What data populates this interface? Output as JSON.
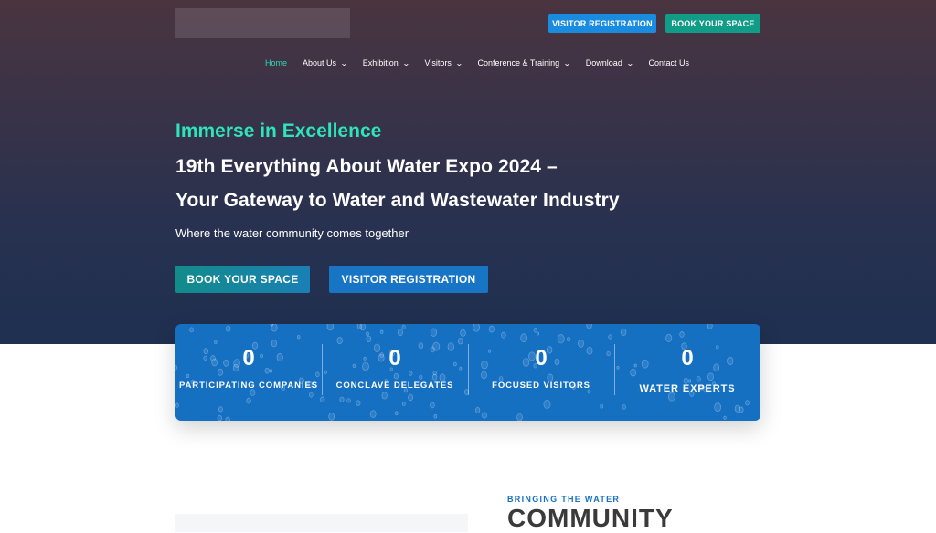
{
  "header": {
    "visitor_registration": "VISITOR REGISTRATION",
    "book_your_space": "BOOK YOUR SPACE"
  },
  "nav": {
    "items": [
      {
        "label": "Home",
        "active": true,
        "has_dropdown": false
      },
      {
        "label": "About Us",
        "has_dropdown": true
      },
      {
        "label": "Exhibition",
        "has_dropdown": true
      },
      {
        "label": "Visitors",
        "has_dropdown": true
      },
      {
        "label": "Conference & Training",
        "has_dropdown": true
      },
      {
        "label": "Download",
        "has_dropdown": true
      },
      {
        "label": "Contact Us",
        "has_dropdown": false
      }
    ],
    "dropdown_icon": "chevron-down-icon"
  },
  "hero": {
    "tagline": "Immerse in Excellence",
    "headline_line1": "19th Everything About Water Expo 2024 –",
    "headline_line2": "Your Gateway to Water and Wastewater Industry",
    "subline": "Where the water community comes together",
    "cta_book": "BOOK YOUR SPACE",
    "cta_visitor": "VISITOR REGISTRATION"
  },
  "stats": [
    {
      "value": "0",
      "label": "PARTICIPATING COMPANIES"
    },
    {
      "value": "0",
      "label": "CONCLAVE DELEGATES"
    },
    {
      "value": "0",
      "label": "FOCUSED VISITORS"
    },
    {
      "value": "0",
      "label": "WATER EXPERTS"
    }
  ],
  "section": {
    "eyebrow": "BRINGING THE WATER",
    "title": "COMMUNITY"
  },
  "colors": {
    "accent_teal": "#2ee3bd",
    "brand_blue": "#1670c2",
    "book_green": "#109c86",
    "visitor_blue": "#1a8ce0"
  }
}
